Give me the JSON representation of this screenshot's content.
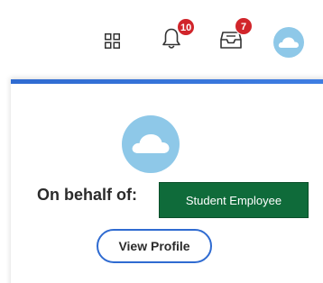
{
  "header": {
    "apps_icon": "grid-icon",
    "notifications": {
      "icon": "bell-icon",
      "count": "10"
    },
    "inbox": {
      "icon": "inbox-icon",
      "count": "7"
    },
    "avatar_icon": "cloud-avatar-icon"
  },
  "profile": {
    "avatar_icon": "cloud-avatar-icon",
    "on_behalf_label": "On behalf of:",
    "role": "Student Employee",
    "view_profile_label": "View Profile"
  },
  "colors": {
    "accent_blue": "#2f6bd1",
    "badge_red": "#d1252b",
    "role_green": "#0f6b3a",
    "avatar_blue": "#8ec8e8"
  }
}
